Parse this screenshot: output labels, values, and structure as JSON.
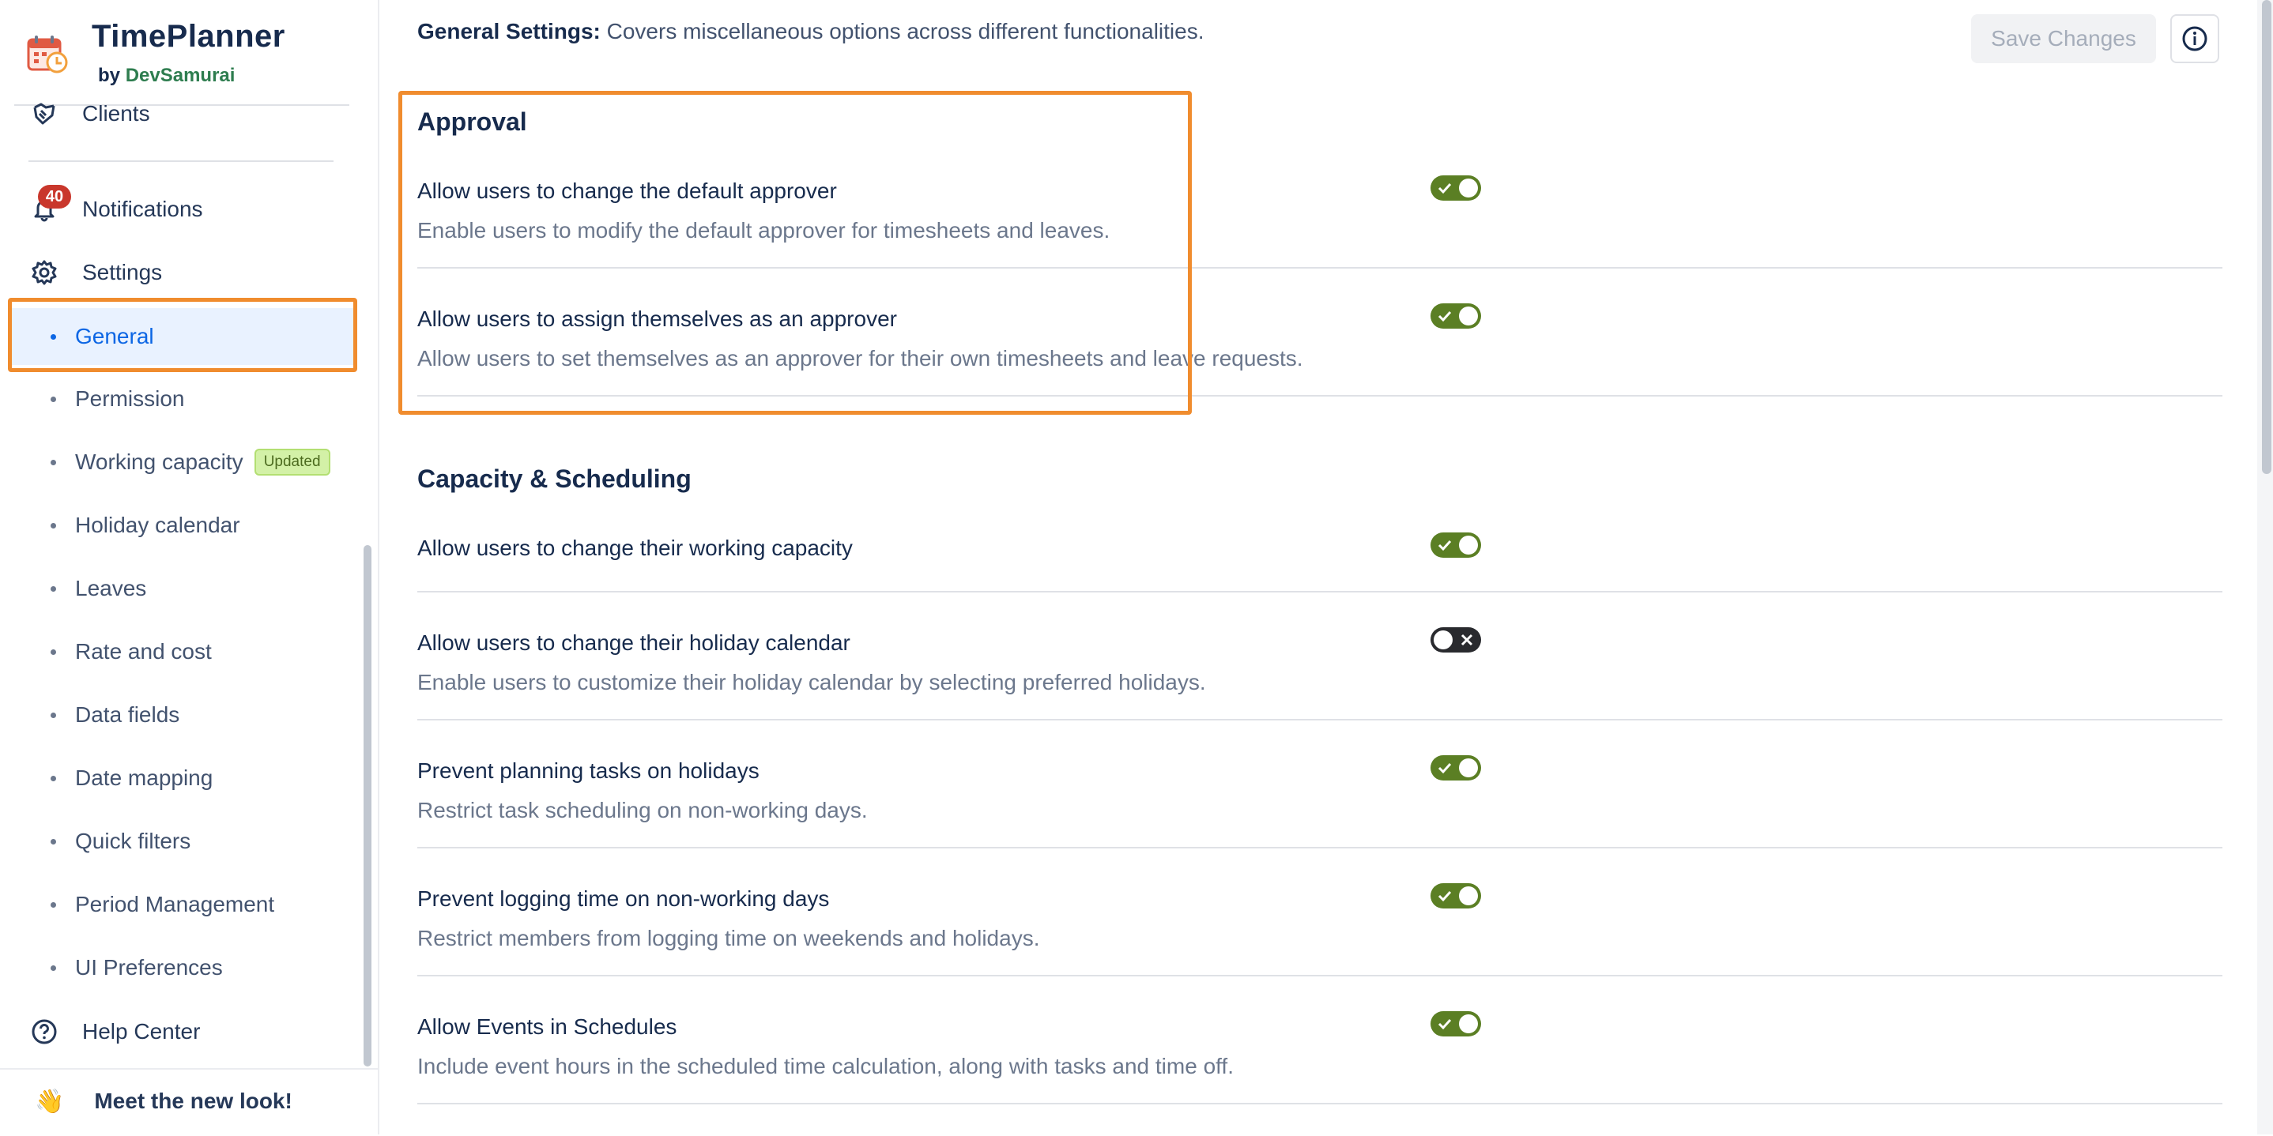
{
  "brand": {
    "title": "TimePlanner",
    "by": "by",
    "company": "DevSamurai"
  },
  "sidebar": {
    "clients": "Clients",
    "notifications": {
      "label": "Notifications",
      "count": "40"
    },
    "settings": "Settings",
    "items": [
      {
        "label": "General",
        "active": true
      },
      {
        "label": "Permission"
      },
      {
        "label": "Working capacity",
        "badge": "Updated"
      },
      {
        "label": "Holiday calendar"
      },
      {
        "label": "Leaves"
      },
      {
        "label": "Rate and cost"
      },
      {
        "label": "Data fields"
      },
      {
        "label": "Date mapping"
      },
      {
        "label": "Quick filters"
      },
      {
        "label": "Period Management"
      },
      {
        "label": "UI Preferences"
      }
    ],
    "help": "Help Center",
    "new_look": {
      "emoji": "👋",
      "label": "Meet the new look!"
    }
  },
  "header": {
    "title": "General Settings:",
    "description": "Covers miscellaneous options across different functionalities.",
    "save_label": "Save Changes"
  },
  "sections": {
    "approval": {
      "title": "Approval",
      "rows": [
        {
          "title": "Allow users to change the default approver",
          "desc": "Enable users to modify the default approver for timesheets and leaves.",
          "enabled": true
        },
        {
          "title": "Allow users to assign themselves as an approver",
          "desc": "Allow users to set themselves as an approver for their own timesheets and leave requests.",
          "enabled": true
        }
      ]
    },
    "capacity": {
      "title": "Capacity & Scheduling",
      "rows": [
        {
          "title": "Allow users to change their working capacity",
          "enabled": true
        },
        {
          "title": "Allow users to change their holiday calendar",
          "desc": "Enable users to customize their holiday calendar by selecting preferred holidays.",
          "enabled": false
        },
        {
          "title": "Prevent planning tasks on holidays",
          "desc": "Restrict task scheduling on non-working days.",
          "enabled": true
        },
        {
          "title": "Prevent logging time on non-working days",
          "desc": "Restrict members from logging time on weekends and holidays.",
          "enabled": true
        },
        {
          "title": "Allow Events in Schedules",
          "desc": "Include event hours in the scheduled time calculation, along with tasks and time off.",
          "enabled": true
        }
      ]
    }
  },
  "colors": {
    "accent": "#0c66e4",
    "toggle_on": "#5b7f24",
    "toggle_off": "#292a2e",
    "highlight": "#f08c2e",
    "badge": "#c9372c"
  }
}
